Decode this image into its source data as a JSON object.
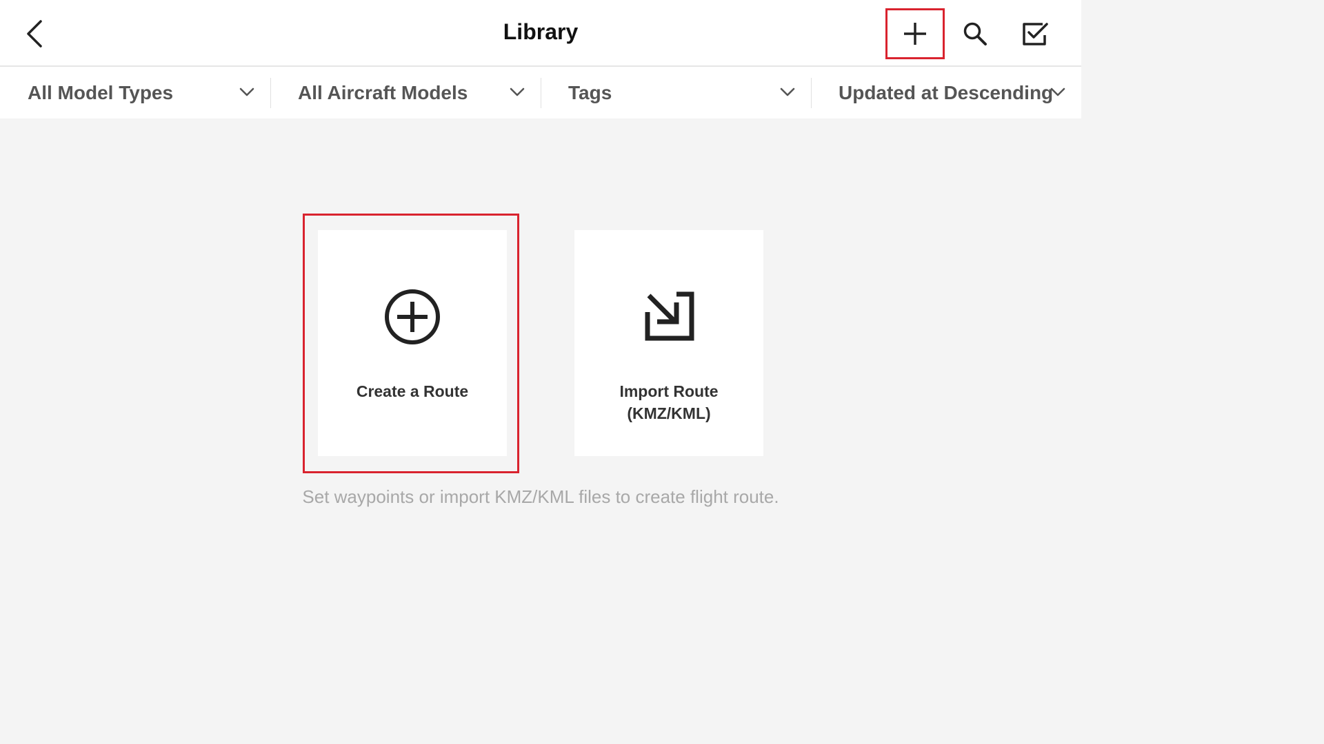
{
  "header": {
    "title": "Library",
    "back_icon": "chevron-left-icon",
    "actions": [
      {
        "name": "add",
        "icon": "plus-icon"
      },
      {
        "name": "search",
        "icon": "search-icon"
      },
      {
        "name": "select",
        "icon": "checkbox-icon"
      }
    ]
  },
  "filters": [
    {
      "label": "All Model Types"
    },
    {
      "label": "All Aircraft Models"
    },
    {
      "label": "Tags"
    },
    {
      "label": "Updated at Descending"
    }
  ],
  "cards": {
    "create": {
      "label": "Create a Route",
      "icon": "plus-circle-icon"
    },
    "import": {
      "label_line1": "Import Route",
      "label_line2": "(KMZ/KML)",
      "icon": "import-arrow-icon"
    }
  },
  "hint": "Set waypoints or import KMZ/KML files to create flight route.",
  "colors": {
    "highlight": "#d9232e",
    "background": "#f4f4f4",
    "card": "#ffffff"
  }
}
